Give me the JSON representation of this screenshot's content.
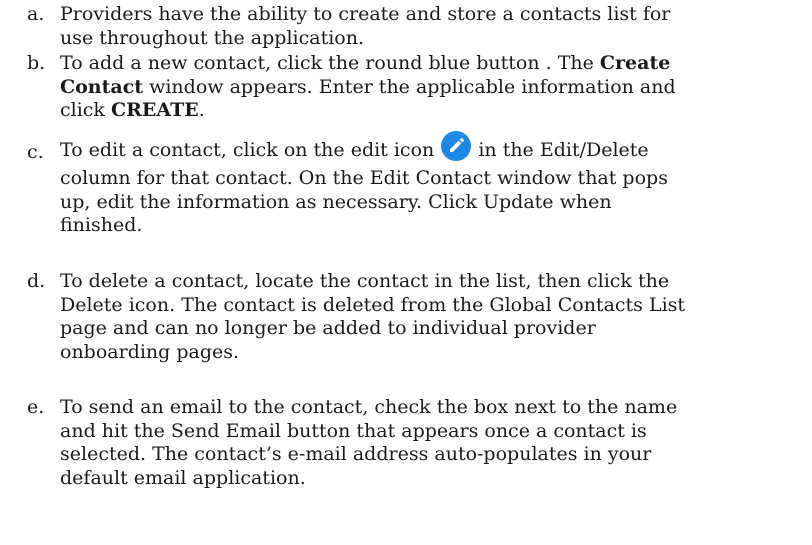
{
  "items": [
    {
      "marker": "a.",
      "lines": [
        "Providers have the ability to create and store a contacts list for",
        "use throughout the application."
      ]
    },
    {
      "marker": "b.",
      "line1": "To add a new contact, click the round blue button . The ",
      "line1_bold": "Create",
      "line2_bold": "Contact",
      "line2": " window appears. Enter the applicable information and",
      "line3": "click ",
      "line3_bold": "CREATE",
      "line3_end": "."
    },
    {
      "marker": "c.",
      "line1_start": "To edit a contact, click on the edit icon ",
      "line1_end": " in the Edit/Delete",
      "icon": "edit-pencil-icon",
      "icon_color": "#1e88e5",
      "lines": [
        "column for that contact. On the Edit Contact window that pops",
        "up, edit the information as necessary. Click Update when",
        "finished."
      ]
    },
    {
      "marker": "d.",
      "lines": [
        "To delete a contact, locate the contact in the list, then click the",
        "Delete icon.  The contact is deleted from the Global Contacts List",
        "page and can no longer be added to individual provider",
        "onboarding pages."
      ]
    },
    {
      "marker": "e.",
      "lines": [
        "To send an email to the contact, check the box next to the name",
        "and hit the Send Email button that appears once a contact is",
        "selected.  The contact’s e-mail address auto-populates in your",
        "default email application."
      ]
    }
  ]
}
